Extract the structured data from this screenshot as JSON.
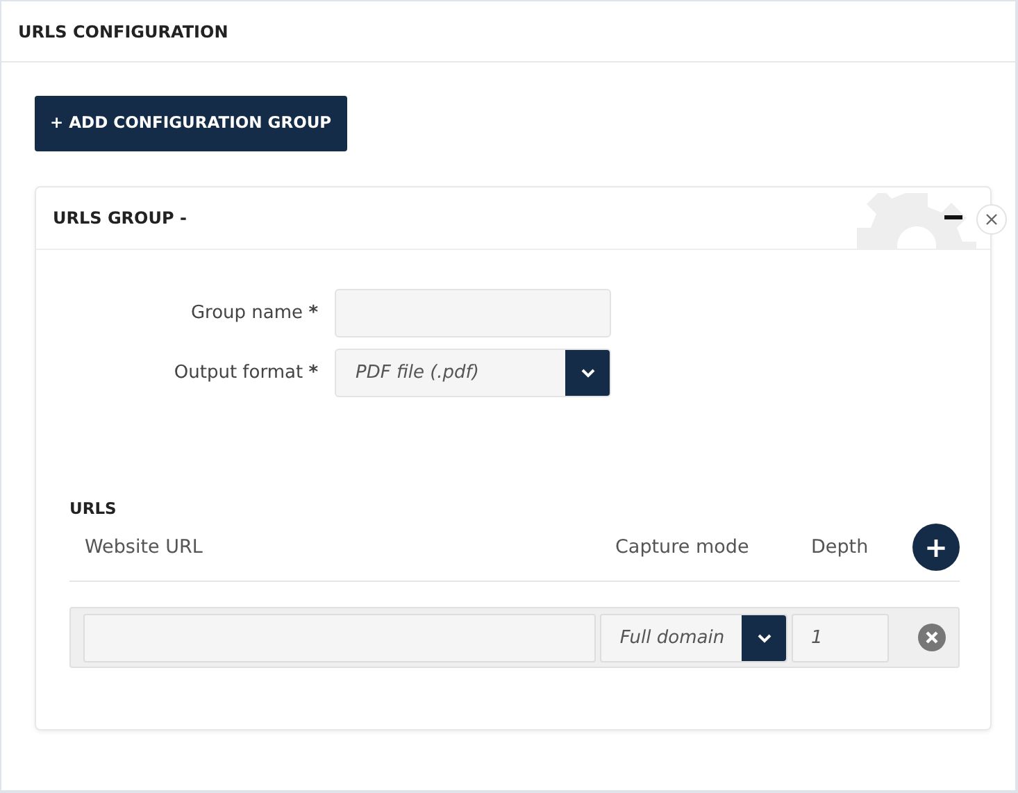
{
  "panel": {
    "title": "URLS CONFIGURATION"
  },
  "add_button": "+ ADD CONFIGURATION GROUP",
  "group": {
    "title": "URLS GROUP -",
    "fields": [
      {
        "kind": "text",
        "label": "Group name",
        "required_mark": "*"
      },
      {
        "kind": "select",
        "label": "Output format",
        "required_mark": "*",
        "value": "PDF file (.pdf)"
      }
    ],
    "urls": {
      "title": "URLS",
      "columns": [
        "Website URL",
        "Capture mode",
        "Depth"
      ],
      "add_icon": "+",
      "rows": [
        {
          "capture_mode": "Full domain",
          "depth": "1"
        }
      ]
    }
  }
}
